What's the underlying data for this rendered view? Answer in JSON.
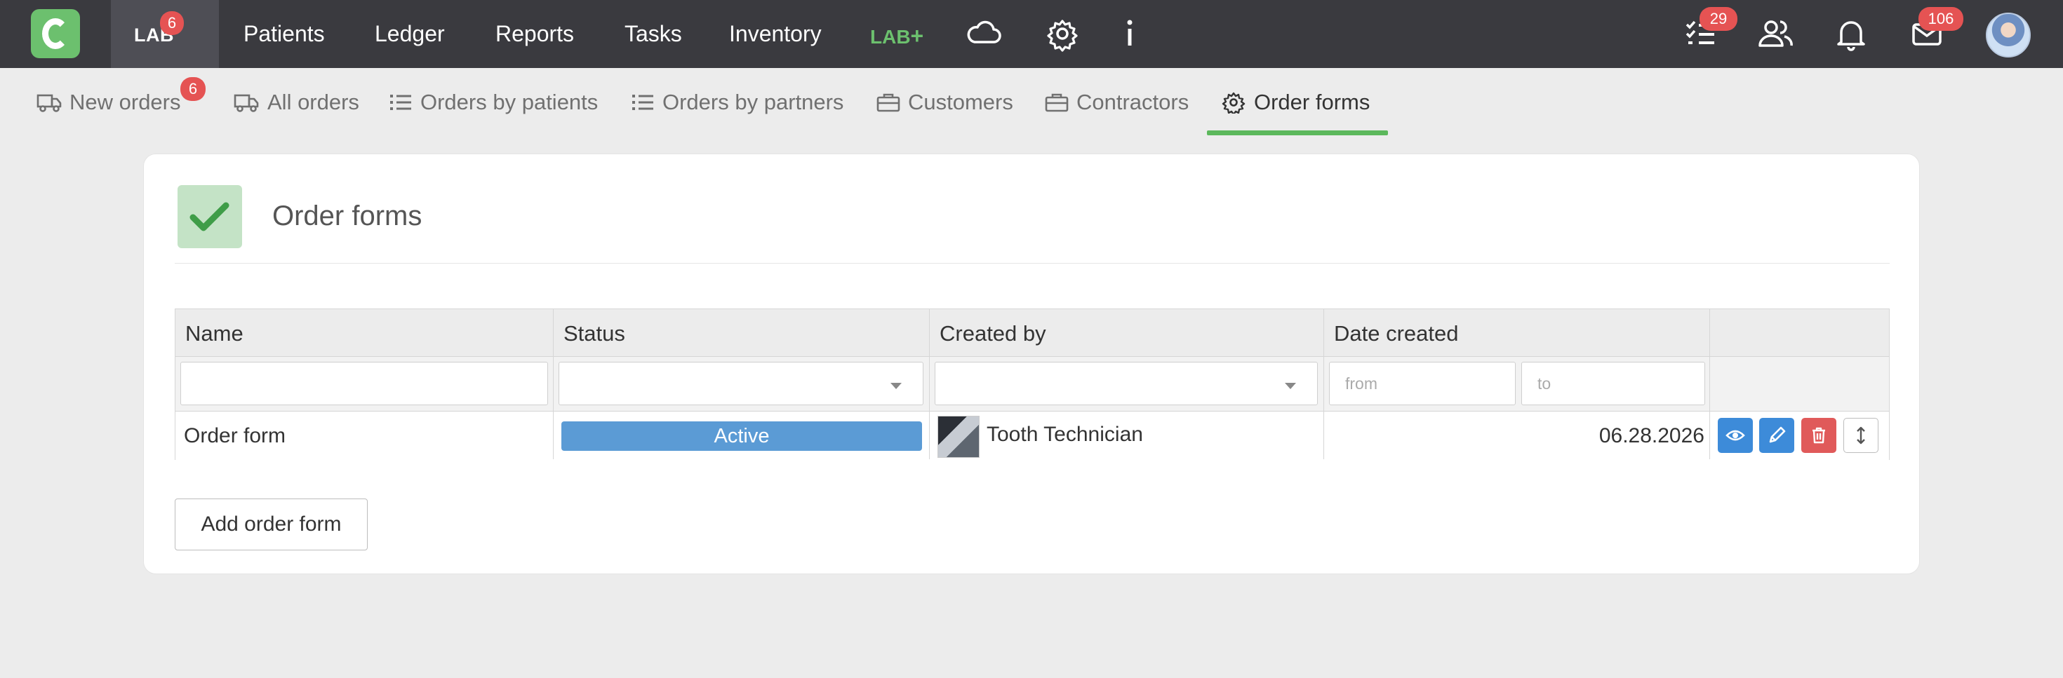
{
  "topbar": {
    "lab_label": "LAB",
    "lab_badge": "6",
    "nav": [
      {
        "label": "Patients"
      },
      {
        "label": "Ledger"
      },
      {
        "label": "Reports"
      },
      {
        "label": "Tasks"
      },
      {
        "label": "Inventory"
      }
    ],
    "labplus_text": "LAB",
    "labplus_symbol": "+",
    "tasks_badge": "29",
    "messages_badge": "106",
    "icons": [
      "cloud-icon",
      "gear-icon",
      "info-icon",
      "checklist-icon",
      "users-icon",
      "bell-icon",
      "envelope-icon"
    ]
  },
  "subnav": {
    "items": [
      {
        "label": "New orders",
        "icon": "truck-icon"
      },
      {
        "label": "All orders",
        "icon": "truck-icon"
      },
      {
        "label": "Orders by patients",
        "icon": "list-icon"
      },
      {
        "label": "Orders by partners",
        "icon": "list-icon"
      },
      {
        "label": "Customers",
        "icon": "briefcase-icon"
      },
      {
        "label": "Contractors",
        "icon": "briefcase-icon"
      },
      {
        "label": "Order forms",
        "icon": "gear-icon"
      }
    ],
    "new_orders_badge": "6",
    "active_index": 6
  },
  "card": {
    "title": "Order forms"
  },
  "table": {
    "columns": [
      "Name",
      "Status",
      "Created by",
      "Date created"
    ],
    "filters": {
      "name_value": "",
      "status_value": "",
      "created_by_value": "",
      "date_from_placeholder": "from",
      "date_to_placeholder": "to"
    },
    "rows": [
      {
        "name": "Order form",
        "status": "Active",
        "created_by": "Tooth Technician",
        "date_created": "06.28.2026"
      }
    ]
  },
  "add_button_label": "Add order form",
  "colors": {
    "topbar": "#3a3a3f",
    "brand_green": "#6cc06e",
    "badge_red": "#e55353",
    "status_blue": "#5b9bd5",
    "action_blue": "#3d8bd9",
    "action_red": "#e05a5a",
    "active_underline": "#5cb85c"
  }
}
